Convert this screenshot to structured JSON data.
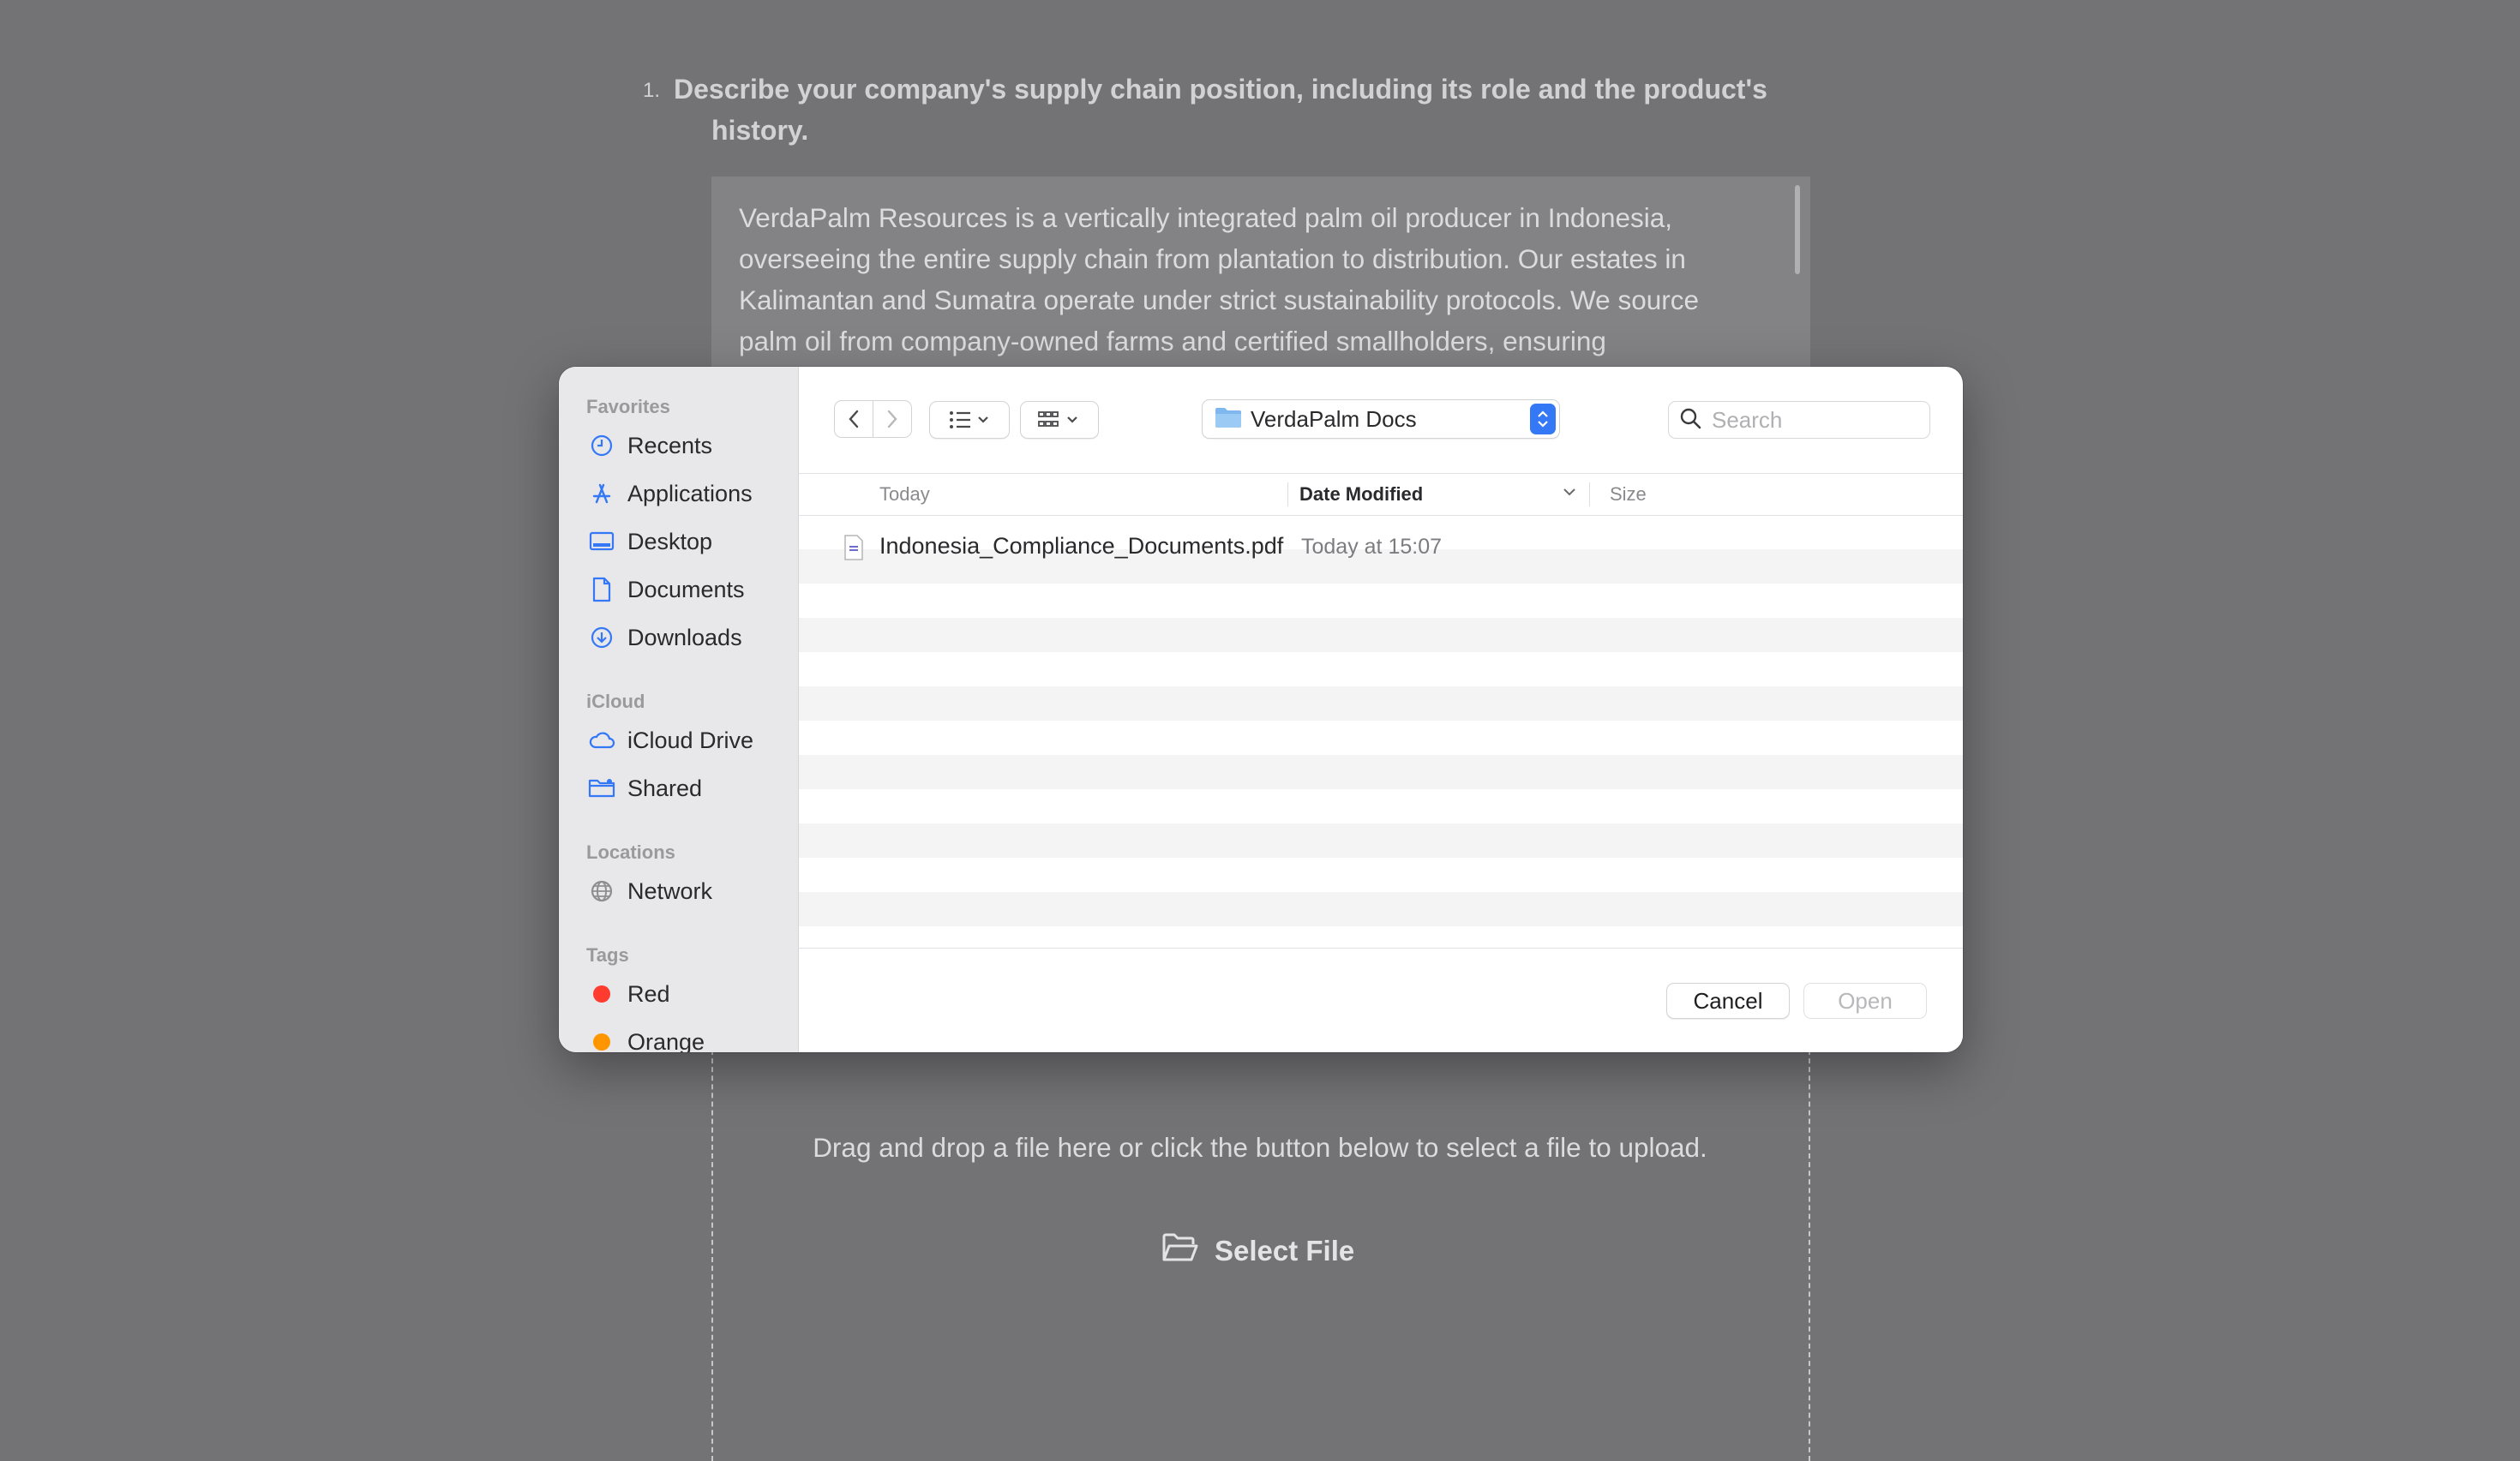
{
  "question": {
    "number": "1.",
    "text_line1": "Describe your company's supply chain position, including its role and the product's",
    "text_line2": "history."
  },
  "answer": {
    "lines": [
      "VerdaPalm Resources is a vertically integrated palm oil producer in Indonesia,",
      "overseeing the entire supply chain from plantation to distribution. Our estates in",
      "Kalimantan and Sumatra operate under strict sustainability protocols. We source",
      "palm oil from company-owned farms and certified smallholders, ensuring"
    ]
  },
  "upload": {
    "instructions": "Drag and drop a file here or click the button below to select a file to upload.",
    "select_label": "Select File"
  },
  "dialog": {
    "sidebar": {
      "favorites_label": "Favorites",
      "favorites": [
        {
          "label": "Recents",
          "icon": "clock-icon"
        },
        {
          "label": "Applications",
          "icon": "applications-icon"
        },
        {
          "label": "Desktop",
          "icon": "desktop-icon"
        },
        {
          "label": "Documents",
          "icon": "document-icon"
        },
        {
          "label": "Downloads",
          "icon": "download-icon"
        }
      ],
      "icloud_label": "iCloud",
      "icloud": [
        {
          "label": "iCloud Drive",
          "icon": "cloud-icon"
        },
        {
          "label": "Shared",
          "icon": "shared-folder-icon"
        }
      ],
      "locations_label": "Locations",
      "locations": [
        {
          "label": "Network",
          "icon": "globe-icon"
        }
      ],
      "tags_label": "Tags",
      "tags": [
        {
          "label": "Red",
          "color": "#ff3b30"
        },
        {
          "label": "Orange",
          "color": "#ff9500"
        }
      ]
    },
    "toolbar": {
      "folder_name": "VerdaPalm Docs",
      "search_placeholder": "Search"
    },
    "columns": {
      "group": "Today",
      "date_modified": "Date Modified",
      "size": "Size"
    },
    "files": [
      {
        "name": "Indonesia_Compliance_Documents.pdf",
        "date": "Today at 15:07"
      }
    ],
    "buttons": {
      "cancel": "Cancel",
      "open": "Open"
    },
    "colors": {
      "accent": "#3478f6",
      "sidebar_icon": "#3478f6"
    }
  }
}
